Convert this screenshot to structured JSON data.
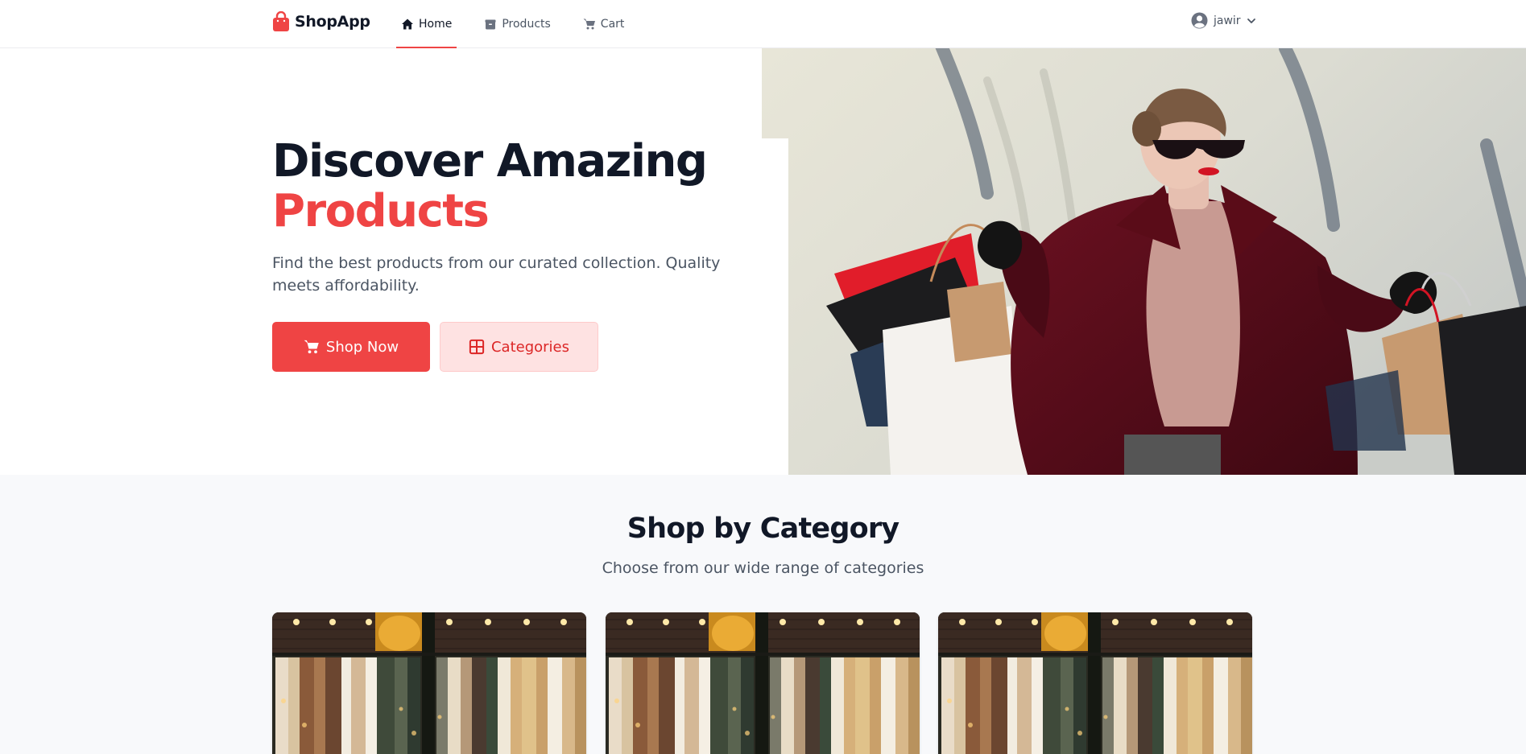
{
  "brand": {
    "name": "ShopApp",
    "color": "#ef4444"
  },
  "nav": {
    "items": [
      {
        "label": "Home",
        "icon": "home-icon",
        "active": true
      },
      {
        "label": "Products",
        "icon": "box-icon",
        "active": false
      },
      {
        "label": "Cart",
        "icon": "cart-icon",
        "active": false
      }
    ]
  },
  "user": {
    "name": "jawir",
    "icon": "user-circle-icon",
    "dropdown_icon": "chevron-down-icon"
  },
  "hero": {
    "title_line1": "Discover Amazing",
    "title_line2": "Products",
    "subtitle": "Find the best products from our curated collection. Quality meets affordability.",
    "primary_button": {
      "label": "Shop Now",
      "icon": "cart-icon"
    },
    "secondary_button": {
      "label": "Categories",
      "icon": "grid-icon"
    },
    "image": "woman-with-shopping-bags-photo"
  },
  "categories": {
    "title": "Shop by Category",
    "subtitle": "Choose from our wide range of categories",
    "cards": [
      {
        "image": "clothing-rack-photo"
      },
      {
        "image": "clothing-rack-photo"
      },
      {
        "image": "clothing-rack-photo"
      }
    ]
  },
  "colors": {
    "accent": "#ef4444",
    "accent_light": "#fee2e2",
    "text_dark": "#111827",
    "text_muted": "#4b5563",
    "page_bg": "#f8f9fb"
  }
}
